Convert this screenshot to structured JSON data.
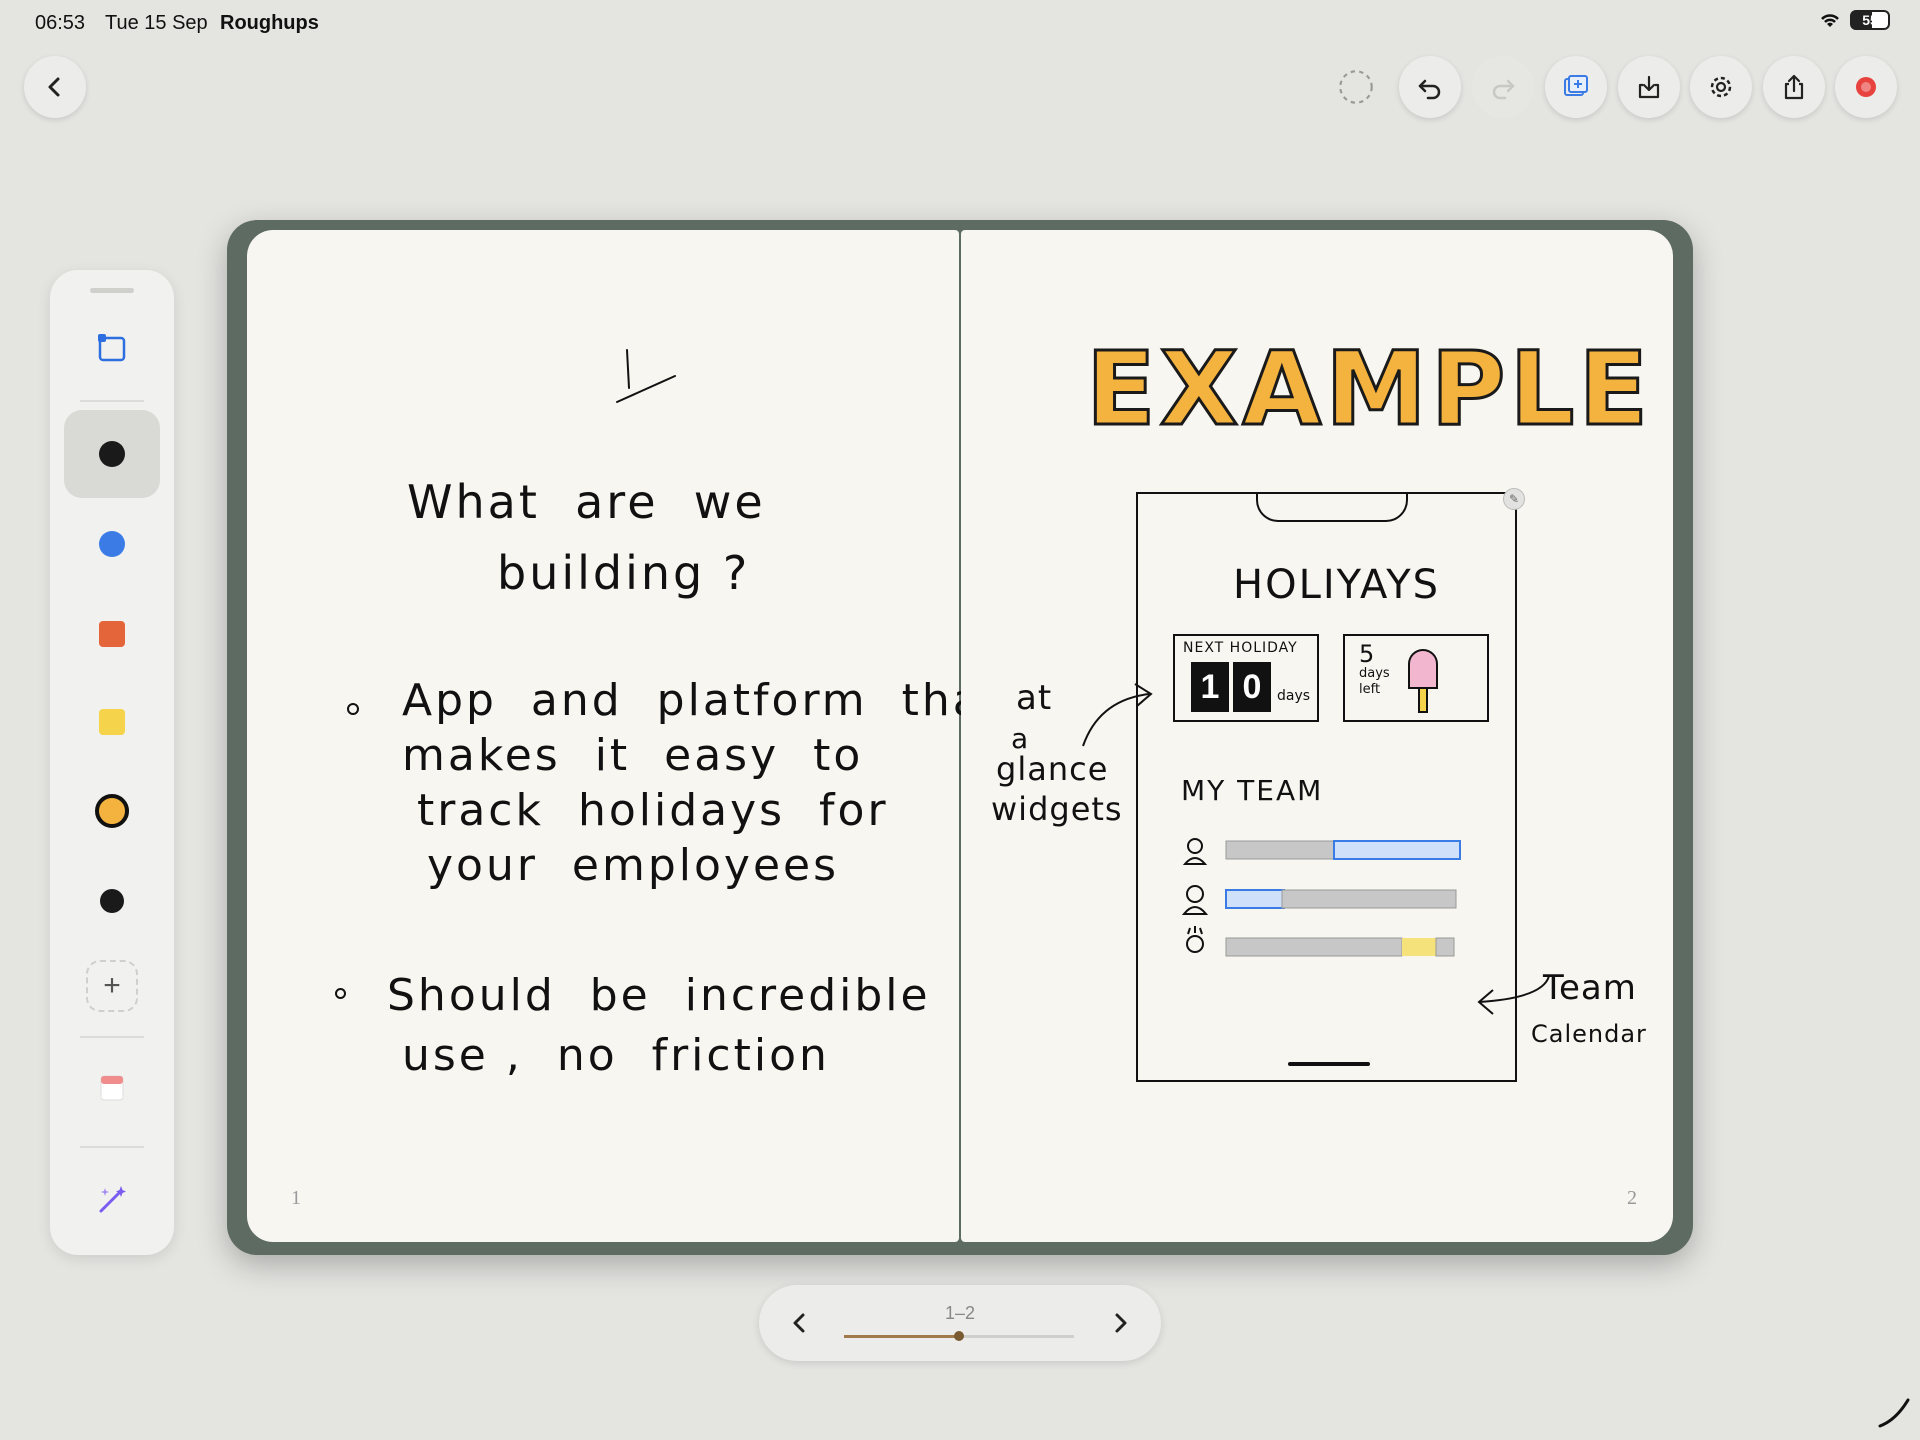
{
  "status_bar": {
    "time": "06:53",
    "date": "Tue 15 Sep",
    "app_name": "Roughups",
    "battery": "55"
  },
  "toolbar": {
    "back": "chevron-left-icon",
    "lasso": "lasso-icon",
    "undo": "undo-icon",
    "redo": "redo-icon",
    "add_page": "add-page-icon",
    "import": "import-icon",
    "settings": "gear-icon",
    "share": "share-icon",
    "record": "record-icon",
    "record_color": "#e8423f"
  },
  "sidebar": {
    "tools": [
      {
        "name": "shape-tool",
        "color": "#2d6fe0"
      },
      {
        "name": "pen-black",
        "color": "#1a1a1a"
      },
      {
        "name": "pen-blue",
        "color": "#3a7be6"
      },
      {
        "name": "marker-orange",
        "color": "#e5653a"
      },
      {
        "name": "marker-yellow",
        "color": "#f5d44b"
      },
      {
        "name": "pen-amber",
        "color": "#f4b23f"
      },
      {
        "name": "pen-black-small",
        "color": "#1a1a1a"
      }
    ],
    "add": "+",
    "sticker": "sticker-icon",
    "magic": "magic-wand-icon"
  },
  "notebook": {
    "left_page": {
      "title_line_1": "What  are  we",
      "title_line_2": "building ?",
      "bullet_1_lines": [
        "App  and  platform  that",
        "makes  it  easy  to",
        "track  holidays  for",
        "your  employees"
      ],
      "bullet_2_lines": [
        "Should  be  incredible  to",
        "use ,  no  friction"
      ],
      "page_number": "1"
    },
    "right_page": {
      "heading": "EXAMPLE",
      "heading_color": "#f4b23f",
      "phone_title": "HOLIYAYS",
      "widget_next_label": "NEXT HOLIDAY",
      "widget_next_digit_1": "1",
      "widget_next_digit_2": "0",
      "widget_next_unit": "days",
      "widget_left_number": "5",
      "widget_left_text_1": "days",
      "widget_left_text_2": "left",
      "team_heading": "MY TEAM",
      "annotation_left": [
        "at",
        "a",
        "glance",
        "widgets"
      ],
      "annotation_right": [
        "Team",
        "Calendar"
      ],
      "page_number": "2"
    }
  },
  "pager": {
    "label": "1–2",
    "progress": 0.5
  }
}
